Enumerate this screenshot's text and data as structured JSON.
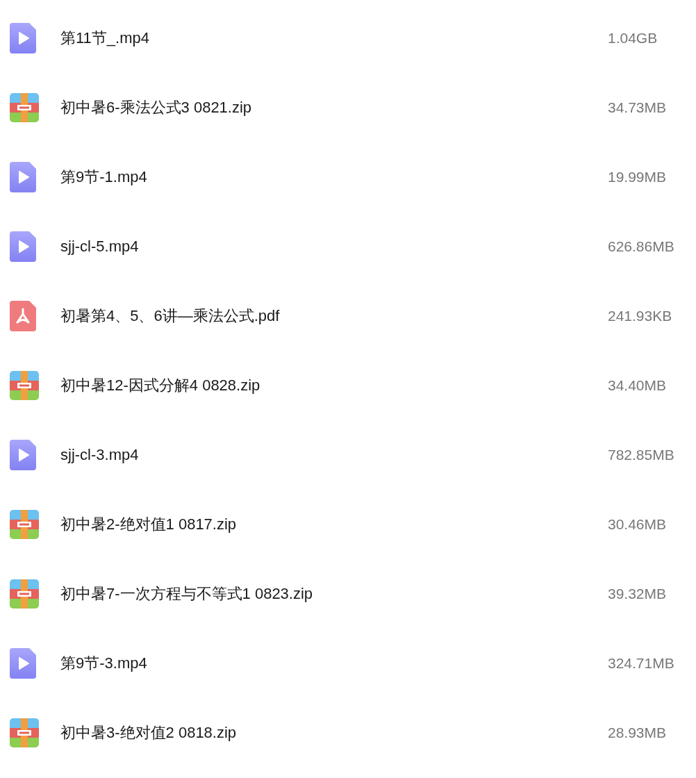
{
  "files": [
    {
      "kind": "video",
      "name": "第11节_.mp4",
      "size": "1.04GB"
    },
    {
      "kind": "archive",
      "name": "初中暑6-乘法公式3 0821.zip",
      "size": "34.73MB"
    },
    {
      "kind": "video",
      "name": "第9节-1.mp4",
      "size": "19.99MB"
    },
    {
      "kind": "video",
      "name": "sjj-cl-5.mp4",
      "size": "626.86MB"
    },
    {
      "kind": "pdf",
      "name": "初暑第4、5、6讲—乘法公式.pdf",
      "size": "241.93KB"
    },
    {
      "kind": "archive",
      "name": "初中暑12-因式分解4 0828.zip",
      "size": "34.40MB"
    },
    {
      "kind": "video",
      "name": "sjj-cl-3.mp4",
      "size": "782.85MB"
    },
    {
      "kind": "archive",
      "name": "初中暑2-绝对值1 0817.zip",
      "size": "30.46MB"
    },
    {
      "kind": "archive",
      "name": "初中暑7-一次方程与不等式1 0823.zip",
      "size": "39.32MB"
    },
    {
      "kind": "video",
      "name": "第9节-3.mp4",
      "size": "324.71MB"
    },
    {
      "kind": "archive",
      "name": "初中暑3-绝对值2 0818.zip",
      "size": "28.93MB"
    }
  ]
}
